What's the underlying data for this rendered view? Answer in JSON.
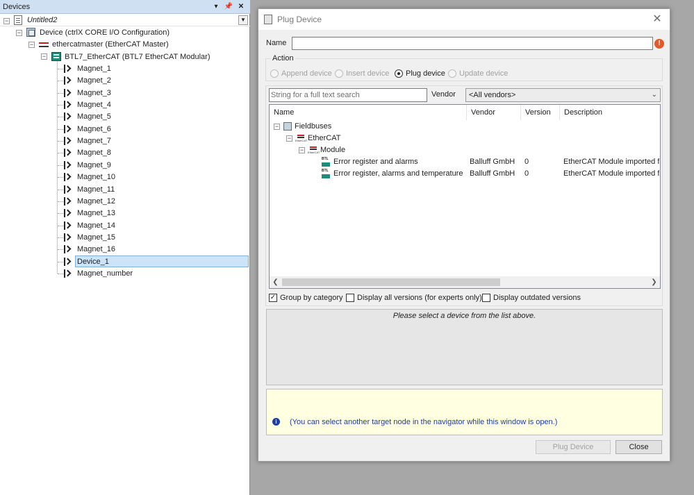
{
  "devices_panel": {
    "title": "Devices",
    "pin_glyph": "▾",
    "dock_glyph": "⬍",
    "close_glyph": "✕",
    "tree": {
      "root": "Untitled2",
      "device": "Device (ctrlX CORE I/O Configuration)",
      "master": "ethercatmaster (EtherCAT Master)",
      "module": "BTL7_EtherCAT (BTL7 EtherCAT Modular)",
      "children": [
        "Magnet_1",
        "Magnet_2",
        "Magnet_3",
        "Magnet_4",
        "Magnet_5",
        "Magnet_6",
        "Magnet_7",
        "Magnet_8",
        "Magnet_9",
        "Magnet_10",
        "Magnet_11",
        "Magnet_12",
        "Magnet_13",
        "Magnet_14",
        "Magnet_15",
        "Magnet_16",
        "Device_1",
        "Magnet_number"
      ],
      "selected": "Device_1"
    }
  },
  "dialog": {
    "title": "Plug Device",
    "close_glyph": "✕",
    "name_label": "Name",
    "name_value": "",
    "action_label": "Action",
    "actions": [
      {
        "label": "Append device",
        "selected": false,
        "enabled": false
      },
      {
        "label": "Insert device",
        "selected": false,
        "enabled": false
      },
      {
        "label": "Plug device",
        "selected": true,
        "enabled": true
      },
      {
        "label": "Update device",
        "selected": false,
        "enabled": false
      }
    ],
    "search_placeholder": "String for a full text search",
    "vendor_label": "Vendor",
    "vendor_value": "<All vendors>",
    "columns": [
      "Name",
      "Vendor",
      "Version",
      "Description"
    ],
    "tree": {
      "fieldbuses": "Fieldbuses",
      "ethercat": "EtherCAT",
      "module": "Module",
      "items": [
        {
          "name": "Error register and alarms",
          "vendor": "Balluff GmbH",
          "version": "0",
          "description": "EtherCAT Module imported fron"
        },
        {
          "name": "Error register, alarms and temperature",
          "vendor": "Balluff GmbH",
          "version": "0",
          "description": "EtherCAT Module imported fron"
        }
      ]
    },
    "options": [
      {
        "label": "Group by category",
        "checked": true
      },
      {
        "label": "Display all versions (for experts only)",
        "checked": false
      },
      {
        "label": "Display outdated versions",
        "checked": false
      }
    ],
    "description_text": "Please select a device from the list above.",
    "info_text": "(You can select another target node in the navigator while this window is open.)",
    "buttons": {
      "plug": "Plug Device",
      "close": "Close"
    }
  },
  "colors": {
    "selection": "#cce4f7",
    "info_text": "#1f3ca8",
    "title_bar": "#cfe0f2"
  }
}
